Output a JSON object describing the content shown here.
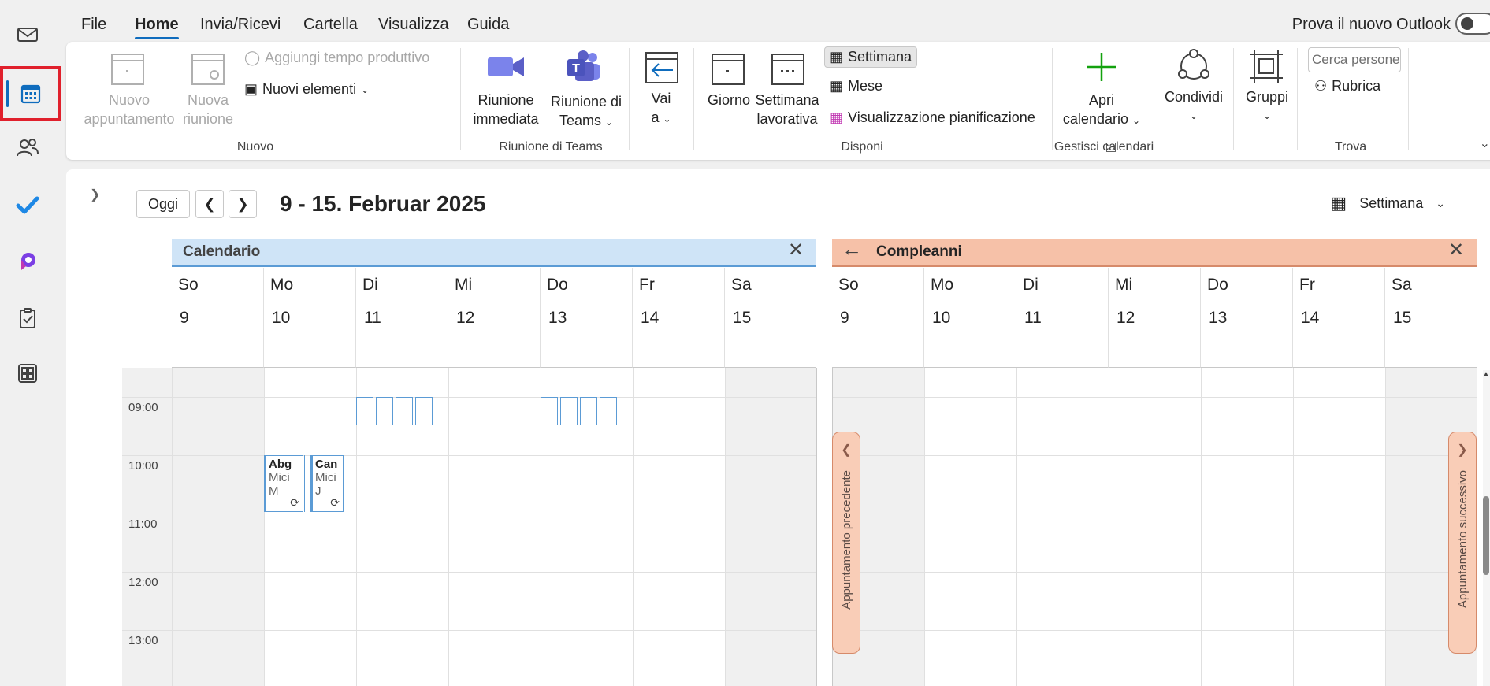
{
  "menu": {
    "file": "File",
    "home": "Home",
    "send_receive": "Invia/Ricevi",
    "folder": "Cartella",
    "view": "Visualizza",
    "help": "Guida",
    "try_new_outlook": "Prova il nuovo Outlook"
  },
  "ribbon": {
    "new_appointment": [
      "Nuovo",
      "appuntamento"
    ],
    "new_meeting": [
      "Nuova",
      "riunione"
    ],
    "add_productive_time": "Aggiungi tempo produttivo",
    "new_items": "Nuovi elementi",
    "group_new": "Nuovo",
    "meet_now": [
      "Riunione",
      "immediata"
    ],
    "teams_meeting": [
      "Riunione di",
      "Teams"
    ],
    "group_teams": "Riunione di Teams",
    "goto": [
      "Vai",
      "a"
    ],
    "day": "Giorno",
    "work_week": [
      "Settimana",
      "lavorativa"
    ],
    "week": "Settimana",
    "month": "Mese",
    "schedule_view": "Visualizzazione pianificazione",
    "group_arrange": "Disponi",
    "open_calendar": [
      "Apri",
      "calendario"
    ],
    "group_manage": "Gestisci calendari",
    "share": "Condividi",
    "groups": "Gruppi",
    "search_people_placeholder": "Cerca persone",
    "address_book": "Rubrica",
    "group_find": "Trova"
  },
  "toolbar": {
    "today": "Oggi",
    "date_range": "9 - 15. Februar 2025",
    "view_label": "Settimana"
  },
  "calendars": [
    {
      "name": "Calendario",
      "header_color": "#cfe4f7",
      "days": [
        {
          "name": "So",
          "num": "9"
        },
        {
          "name": "Mo",
          "num": "10"
        },
        {
          "name": "Di",
          "num": "11"
        },
        {
          "name": "Mi",
          "num": "12"
        },
        {
          "name": "Do",
          "num": "13"
        },
        {
          "name": "Fr",
          "num": "14"
        },
        {
          "name": "Sa",
          "num": "15"
        }
      ]
    },
    {
      "name": "Compleanni",
      "header_color": "#f6c1a8",
      "days": [
        {
          "name": "So",
          "num": "9"
        },
        {
          "name": "Mo",
          "num": "10"
        },
        {
          "name": "Di",
          "num": "11"
        },
        {
          "name": "Mi",
          "num": "12"
        },
        {
          "name": "Do",
          "num": "13"
        },
        {
          "name": "Fr",
          "num": "14"
        },
        {
          "name": "Sa",
          "num": "15"
        }
      ]
    }
  ],
  "hours": [
    "09:00",
    "10:00",
    "11:00",
    "12:00",
    "13:00"
  ],
  "events": [
    {
      "title": "Abg",
      "line1": "Mici",
      "line2": "M"
    },
    {
      "title": "Can",
      "line1": "Mici",
      "line2": "J"
    }
  ],
  "nav": {
    "previous": "Appuntamento precedente",
    "next": "Appuntamento successivo"
  }
}
